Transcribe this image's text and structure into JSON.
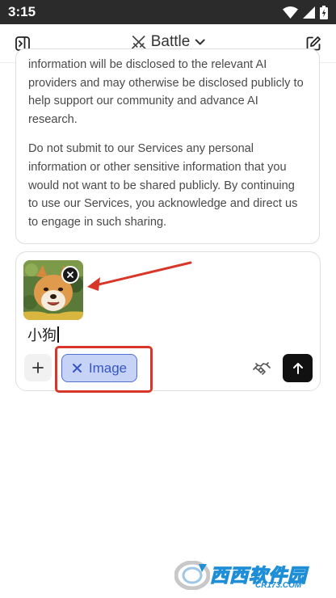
{
  "status_bar": {
    "time": "3:15",
    "icons": [
      "wifi-icon",
      "signal-icon",
      "battery-icon"
    ]
  },
  "app_bar": {
    "mode_label": "Battle",
    "left_icon": "sidebar-toggle-icon",
    "mode_icon": "crossed-swords-icon",
    "right_icon": "new-chat-icon"
  },
  "notice": {
    "paragraph_1": "information will be disclosed to the relevant AI providers and may otherwise be disclosed publicly to help support our community and advance AI research.",
    "paragraph_2": "Do not submit to our Services any personal information or other sensitive information that you would not want to be shared publicly. By continuing to use our Services, you acknowledge and direct us to engage in such sharing."
  },
  "composer": {
    "attachment_icon": "dog-photo-thumbnail",
    "prompt_value": "小狗",
    "chip_label": "Image",
    "chip_icon": "close-icon"
  },
  "watermark": {
    "brand_text": "西西软件园",
    "url_text": "CR173.COM"
  },
  "colors": {
    "status_bar_bg": "#2b2b2b",
    "chip_bg": "#c6d3f7",
    "chip_accent": "#3656c4",
    "annotation_red": "#d9362a",
    "send_button_bg": "#111111"
  }
}
